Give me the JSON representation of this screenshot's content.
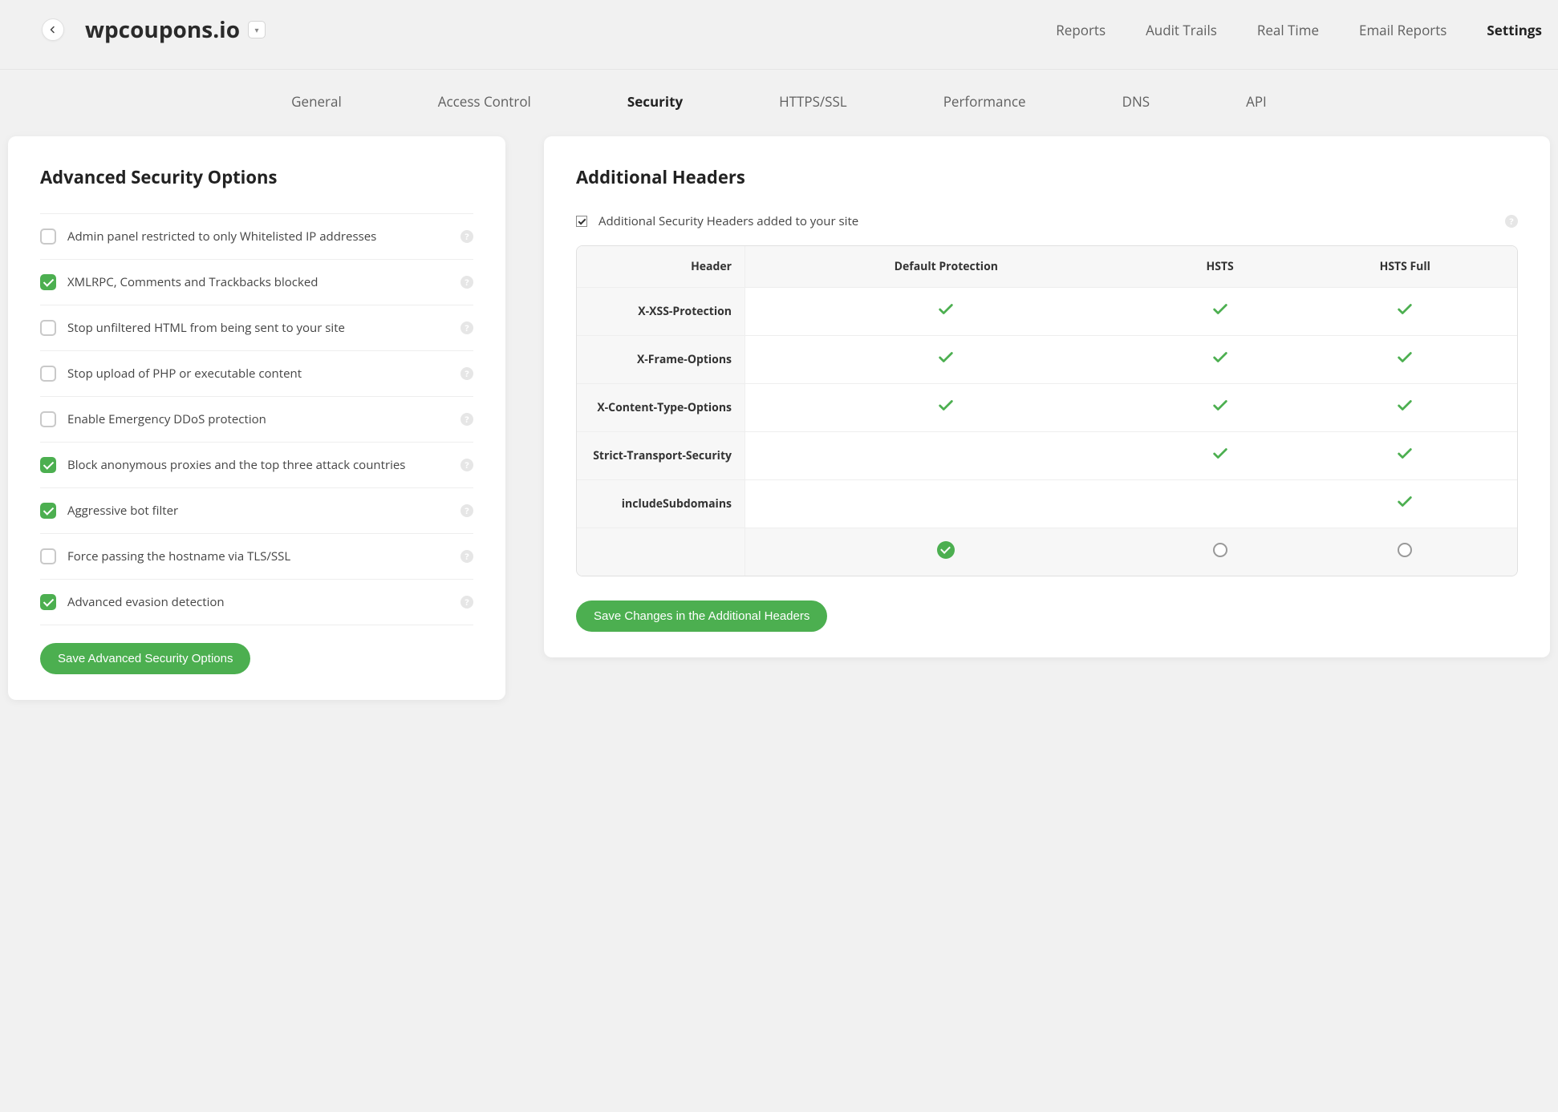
{
  "site_title": "wpcoupons.io",
  "primary_nav": {
    "reports": "Reports",
    "audit": "Audit Trails",
    "realtime": "Real Time",
    "email_reports": "Email Reports",
    "settings": "Settings"
  },
  "sub_nav": {
    "general": "General",
    "access": "Access Control",
    "security": "Security",
    "https": "HTTPS/SSL",
    "perf": "Performance",
    "dns": "DNS",
    "api": "API"
  },
  "left_panel": {
    "title": "Advanced Security Options",
    "save_label": "Save Advanced Security Options",
    "options": [
      {
        "label": "Admin panel restricted to only Whitelisted IP addresses",
        "checked": false
      },
      {
        "label": "XMLRPC, Comments and Trackbacks blocked",
        "checked": true
      },
      {
        "label": "Stop unfiltered HTML from being sent to your site",
        "checked": false
      },
      {
        "label": "Stop upload of PHP or executable content",
        "checked": false
      },
      {
        "label": "Enable Emergency DDoS protection",
        "checked": false
      },
      {
        "label": "Block anonymous proxies and the top three attack countries",
        "checked": true
      },
      {
        "label": "Aggressive bot filter",
        "checked": true
      },
      {
        "label": "Force passing the hostname via TLS/SSL",
        "checked": false
      },
      {
        "label": "Advanced evasion detection",
        "checked": true
      }
    ]
  },
  "right_panel": {
    "title": "Additional Headers",
    "top_checkbox_label": "Additional Security Headers added to your site",
    "top_checkbox_checked": true,
    "save_label": "Save Changes in the Additional Headers",
    "columns": [
      "Header",
      "Default Protection",
      "HSTS",
      "HSTS Full"
    ],
    "rows": [
      {
        "name": "X-XSS-Protection",
        "cols": [
          true,
          true,
          true
        ]
      },
      {
        "name": "X-Frame-Options",
        "cols": [
          true,
          true,
          true
        ]
      },
      {
        "name": "X-Content-Type-Options",
        "cols": [
          true,
          true,
          true
        ]
      },
      {
        "name": "Strict-Transport-Security",
        "cols": [
          false,
          true,
          true
        ]
      },
      {
        "name": "includeSubdomains",
        "cols": [
          false,
          false,
          true
        ]
      }
    ],
    "selected_column": 0
  }
}
